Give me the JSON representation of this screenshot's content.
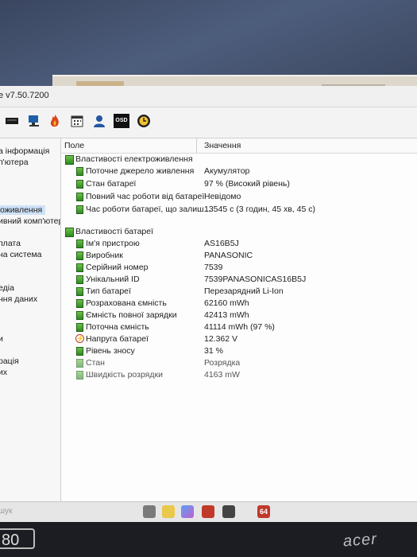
{
  "window": {
    "title": "e v7.50.7200"
  },
  "toolbar": {
    "icons": [
      "report-icon",
      "network-icon",
      "flame-icon",
      "calendar-icon",
      "user-icon",
      "osd-icon",
      "clock-icon"
    ],
    "osd_label": "OSD"
  },
  "left_pane": {
    "items": [
      {
        "label": "а інформація"
      },
      {
        "label": "п'ютера"
      },
      {
        "label": "оживлення",
        "selected": true
      },
      {
        "label": "ивний комп'ютер"
      },
      {
        "label": "плата"
      },
      {
        "label": "на система"
      },
      {
        "label": "едіа"
      },
      {
        "label": "ння даних"
      },
      {
        "label": "и"
      },
      {
        "label": "рація"
      },
      {
        "label": "их"
      }
    ]
  },
  "columns": {
    "field": "Поле",
    "value": "Значення"
  },
  "power_section": {
    "title": "Властивості електроживлення",
    "rows": [
      {
        "label": "Поточне джерело живлення",
        "value": "Акумулятор"
      },
      {
        "label": "Стан батареї",
        "value": "97 % (Високий рівень)"
      },
      {
        "label": "Повний час роботи від батареї",
        "value": "Невідомо"
      },
      {
        "label": "Час роботи батареї, що залиш...",
        "value": "13545 с (3 годин, 45 хв, 45 с)"
      }
    ]
  },
  "battery_section": {
    "title": "Властивості батареї",
    "rows": [
      {
        "label": "Ім'я пристрою",
        "value": "AS16B5J"
      },
      {
        "label": "Виробник",
        "value": "PANASONIC"
      },
      {
        "label": "Серійний номер",
        "value": "7539"
      },
      {
        "label": "Унікальний ID",
        "value": "7539PANASONICAS16B5J"
      },
      {
        "label": "Тип батареї",
        "value": "Перезарядний Li-Ion"
      },
      {
        "label": "Розрахована ємність",
        "value": "62160 mWh"
      },
      {
        "label": "Ємність повної зарядки",
        "value": "42413 mWh"
      },
      {
        "label": "Поточна ємність",
        "value": "41114 mWh  (97 %)"
      },
      {
        "label": "Напруга батареї",
        "value": "12.362 V"
      },
      {
        "label": "Рівень зносу",
        "value": "31 %"
      },
      {
        "label": "Стан",
        "value": "Розрядка"
      },
      {
        "label": "Швидкість розрядки",
        "value": "4163 mW"
      }
    ]
  },
  "taskbar": {
    "search_label": "шук",
    "badge": "64"
  },
  "bezel": {
    "model_number": "80",
    "brand": "acer"
  }
}
